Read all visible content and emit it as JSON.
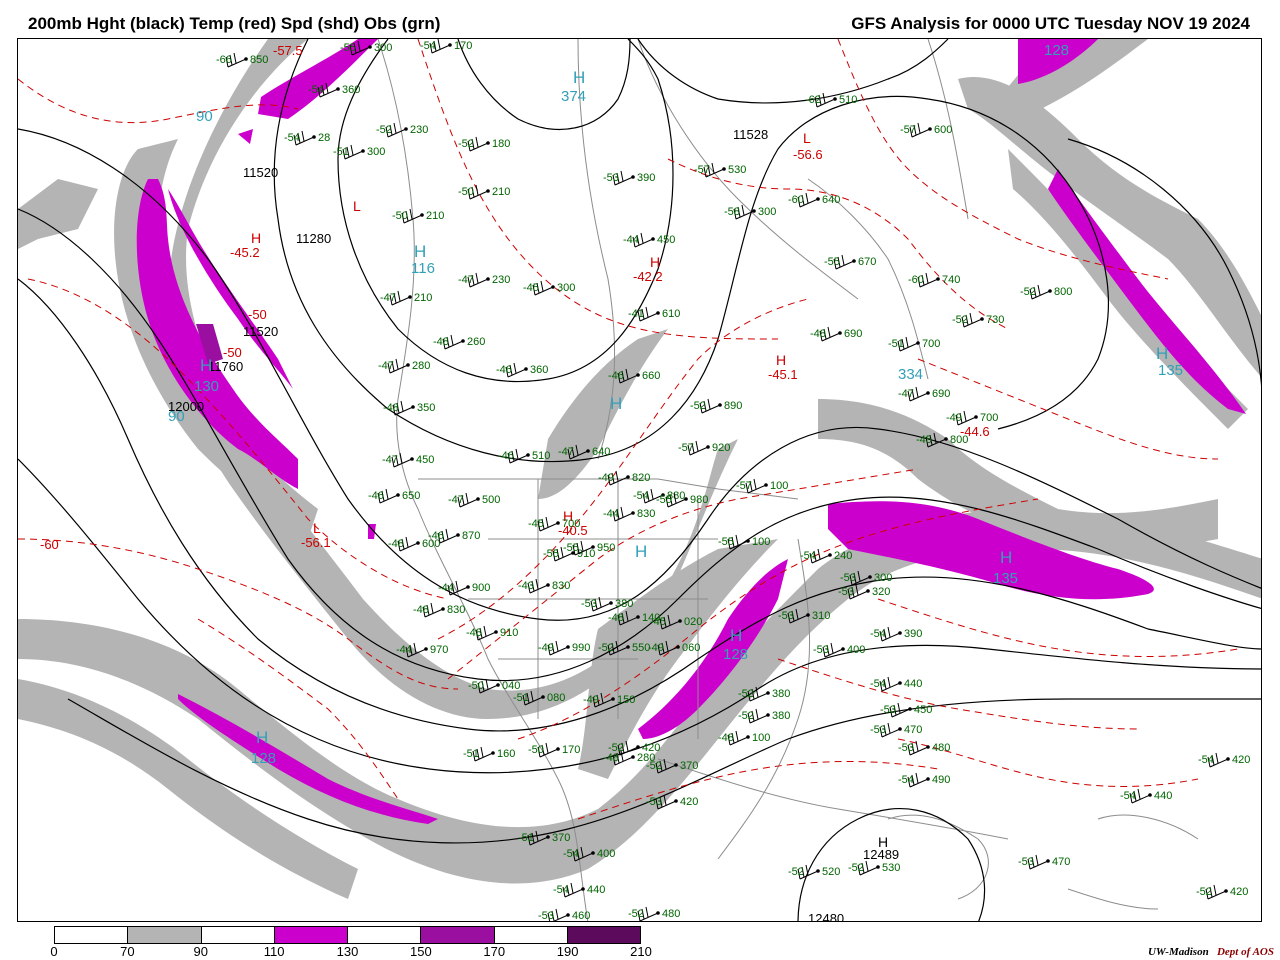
{
  "header": {
    "left_title": "200mb Hght (black) Temp (red) Spd (shd) Obs (grn)",
    "right_title": "GFS Analysis for 0000 UTC Tuesday  NOV 19 2024"
  },
  "credit": {
    "institution": "UW-Madison",
    "department": "Dept of AOS"
  },
  "colors": {
    "height_contours": "#000000",
    "temperature_contours": "#cc0000",
    "observations": "#006400",
    "speed_labels": "#33a0b8",
    "borders": "#8c8c8c"
  },
  "legend": {
    "ticks": [
      "0",
      "70",
      "90",
      "110",
      "130",
      "150",
      "170",
      "190",
      "210"
    ],
    "segment_colors": [
      "#ffffff",
      "#b4b4b4",
      "#ffffff",
      "#cc00cc",
      "#ffffff",
      "#9b0fa0",
      "#ffffff",
      "#5c0a5c"
    ]
  },
  "height_labels": [
    {
      "text": "11520"
    },
    {
      "text": "11280"
    },
    {
      "text": "11520"
    },
    {
      "text": "11760"
    },
    {
      "text": "12000"
    },
    {
      "text": "11528"
    },
    {
      "text": "12489"
    },
    {
      "text": "12480"
    }
  ],
  "temp_labels": [
    {
      "text": "-57.5"
    },
    {
      "text": "-45.2"
    },
    {
      "text": "-42.2"
    },
    {
      "text": "-56.6"
    },
    {
      "text": "-45.1"
    },
    {
      "text": "-56.1"
    },
    {
      "text": "-50"
    },
    {
      "text": "-60"
    },
    {
      "text": "-44.6"
    },
    {
      "text": "-40.5"
    },
    {
      "text": "-50"
    }
  ],
  "speed_labels": [
    {
      "text": "374"
    },
    {
      "text": "116"
    },
    {
      "text": "130"
    },
    {
      "text": "90"
    },
    {
      "text": "128"
    },
    {
      "text": "135"
    },
    {
      "text": "334"
    },
    {
      "text": "135"
    },
    {
      "text": "128"
    },
    {
      "text": "128"
    },
    {
      "text": "90"
    }
  ],
  "observations": [
    {
      "temp": "-54",
      "hgt": "170"
    },
    {
      "temp": "-66",
      "hgt": "850"
    },
    {
      "temp": "-55",
      "hgt": "300"
    },
    {
      "temp": "-54",
      "hgt": "360"
    },
    {
      "temp": "-52",
      "hgt": "230"
    },
    {
      "temp": "-54",
      "hgt": "28"
    },
    {
      "temp": "-51",
      "hgt": "300"
    },
    {
      "temp": "-52",
      "hgt": "180"
    },
    {
      "temp": "-53",
      "hgt": "390"
    },
    {
      "temp": "-50",
      "hgt": "210"
    },
    {
      "temp": "-50",
      "hgt": "210"
    },
    {
      "temp": "-44",
      "hgt": "450"
    },
    {
      "temp": "-47",
      "hgt": "230"
    },
    {
      "temp": "-45",
      "hgt": "300"
    },
    {
      "temp": "-47",
      "hgt": "210"
    },
    {
      "temp": "-48",
      "hgt": "260"
    },
    {
      "temp": "-46",
      "hgt": "360"
    },
    {
      "temp": "-47",
      "hgt": "280"
    },
    {
      "temp": "-48",
      "hgt": "350"
    },
    {
      "temp": "-47",
      "hgt": "450"
    },
    {
      "temp": "-46",
      "hgt": "510"
    },
    {
      "temp": "-47",
      "hgt": "640"
    },
    {
      "temp": "-49",
      "hgt": "820"
    },
    {
      "temp": "-47",
      "hgt": "500"
    },
    {
      "temp": "-54",
      "hgt": "880"
    },
    {
      "temp": "-55",
      "hgt": "980"
    },
    {
      "temp": "-57",
      "hgt": "920"
    },
    {
      "temp": "-52",
      "hgt": "890"
    },
    {
      "temp": "-57",
      "hgt": "530"
    },
    {
      "temp": "-58",
      "hgt": "300"
    },
    {
      "temp": "-62",
      "hgt": "510"
    },
    {
      "temp": "-57",
      "hgt": "600"
    },
    {
      "temp": "-60",
      "hgt": "640"
    },
    {
      "temp": "-55",
      "hgt": "670"
    },
    {
      "temp": "-60",
      "hgt": "740"
    },
    {
      "temp": "-52",
      "hgt": "800"
    },
    {
      "temp": "-52",
      "hgt": "730"
    },
    {
      "temp": "-48",
      "hgt": "690"
    },
    {
      "temp": "-51",
      "hgt": "700"
    },
    {
      "temp": "-47",
      "hgt": "690"
    },
    {
      "temp": "-49",
      "hgt": "700"
    },
    {
      "temp": "-45",
      "hgt": "800"
    },
    {
      "temp": "-41",
      "hgt": "610"
    },
    {
      "temp": "-46",
      "hgt": "660"
    },
    {
      "temp": "-45",
      "hgt": "700"
    },
    {
      "temp": "-44",
      "hgt": "830"
    },
    {
      "temp": "-55",
      "hgt": "910"
    },
    {
      "temp": "-55",
      "hgt": "950"
    },
    {
      "temp": "-55",
      "hgt": "100"
    },
    {
      "temp": "-57",
      "hgt": "100"
    },
    {
      "temp": "-54",
      "hgt": "240"
    },
    {
      "temp": "-53",
      "hgt": "300"
    },
    {
      "temp": "-53",
      "hgt": "320"
    },
    {
      "temp": "-54",
      "hgt": "390"
    },
    {
      "temp": "-53",
      "hgt": "400"
    },
    {
      "temp": "-53",
      "hgt": "310"
    },
    {
      "temp": "-54",
      "hgt": "440"
    },
    {
      "temp": "-53",
      "hgt": "450"
    },
    {
      "temp": "-53",
      "hgt": "470"
    },
    {
      "temp": "-53",
      "hgt": "480"
    },
    {
      "temp": "-54",
      "hgt": "490"
    },
    {
      "temp": "-54",
      "hgt": "420"
    },
    {
      "temp": "-54",
      "hgt": "440"
    },
    {
      "temp": "-53",
      "hgt": "470"
    },
    {
      "temp": "-52",
      "hgt": "420"
    },
    {
      "temp": "-52",
      "hgt": "520"
    },
    {
      "temp": "-52",
      "hgt": "530"
    },
    {
      "temp": "-52",
      "hgt": "480"
    },
    {
      "temp": "-53",
      "hgt": "460"
    },
    {
      "temp": "-54",
      "hgt": "440"
    },
    {
      "temp": "-54",
      "hgt": "400"
    },
    {
      "temp": "-51",
      "hgt": "370"
    },
    {
      "temp": "-53",
      "hgt": "420"
    },
    {
      "temp": "-52",
      "hgt": "370"
    },
    {
      "temp": "-48",
      "hgt": "280"
    },
    {
      "temp": "-50",
      "hgt": "170"
    },
    {
      "temp": "-51",
      "hgt": "160"
    },
    {
      "temp": "-49",
      "hgt": "150"
    },
    {
      "temp": "-51",
      "hgt": "080"
    },
    {
      "temp": "-50",
      "hgt": "040"
    },
    {
      "temp": "-44",
      "hgt": "970"
    },
    {
      "temp": "-48",
      "hgt": "910"
    },
    {
      "temp": "-49",
      "hgt": "990"
    },
    {
      "temp": "-48",
      "hgt": "830"
    },
    {
      "temp": "-44",
      "hgt": "900"
    },
    {
      "temp": "-43",
      "hgt": "830"
    },
    {
      "temp": "-46",
      "hgt": "870"
    },
    {
      "temp": "-48",
      "hgt": "600"
    },
    {
      "temp": "-46",
      "hgt": "650"
    },
    {
      "temp": "-52",
      "hgt": "550"
    },
    {
      "temp": "-49",
      "hgt": "060"
    },
    {
      "temp": "-48",
      "hgt": "140"
    },
    {
      "temp": "-45",
      "hgt": "020"
    },
    {
      "temp": "-48",
      "hgt": "100"
    },
    {
      "temp": "-52",
      "hgt": "380"
    },
    {
      "temp": "-52",
      "hgt": "380"
    },
    {
      "temp": "-53",
      "hgt": "380"
    },
    {
      "temp": "-52",
      "hgt": "420"
    },
    {
      "temp": "-50",
      "hgt": "210"
    },
    {
      "temp": "-48",
      "hgt": "280"
    }
  ]
}
